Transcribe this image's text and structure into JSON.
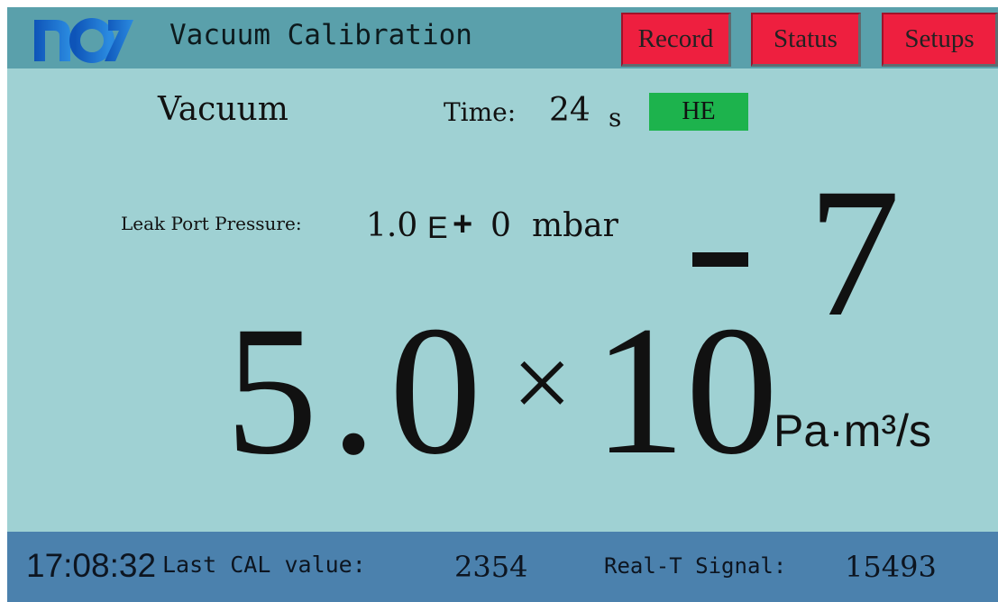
{
  "header": {
    "logo_text": "nci",
    "title": "Vacuum Calibration",
    "buttons": {
      "record": "Record",
      "status": "Status",
      "setups": "Setups"
    }
  },
  "status_row": {
    "mode": "Vacuum",
    "time_label": "Time:",
    "time_value": "24",
    "time_unit": "s",
    "gas": "HE"
  },
  "leak_port": {
    "label": "Leak Port Pressure:",
    "mantissa": "1.0",
    "e": "E",
    "sign": "+",
    "exponent": "0",
    "unit": "mbar"
  },
  "leak_rate": {
    "mantissa": "5.0",
    "times": "×",
    "base": "10",
    "exponent_digit": "7",
    "exponent_sign": "negative",
    "unit": "Pa·m³/s"
  },
  "footer": {
    "clock": "17:08:32",
    "last_cal_label": "Last CAL value:",
    "last_cal_value": "2354",
    "signal_label": "Real-T Signal:",
    "signal_value": "15493"
  },
  "colors": {
    "background": "#9fd1d3",
    "header": "#5aa0ab",
    "footer": "#4b81ad",
    "button": "#ee1f3f",
    "gas_badge": "#1db34d",
    "logo": "#1466c8"
  }
}
